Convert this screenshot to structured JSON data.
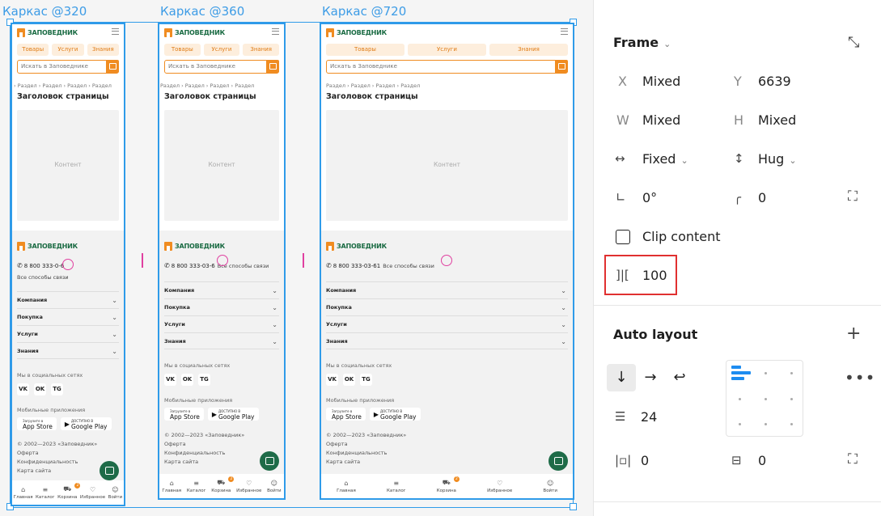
{
  "frames": [
    {
      "label": "Каркас @320",
      "size": "320"
    },
    {
      "label": "Каркас @360",
      "size": "360"
    },
    {
      "label": "Каркас @720",
      "size": "720"
    }
  ],
  "mockup": {
    "logo_text": "ЗАПОВЕДНИК",
    "tabs": [
      "Товары",
      "Услуги",
      "Знания"
    ],
    "search_placeholder": "Искать в Заповеднике",
    "breadcrumb": "Раздел  ›  Раздел  ›  Раздел  ›  Раздел",
    "breadcrumb_short": "›  Раздел  ›  Раздел  ›  Раздел  ›  Раздел",
    "title": "Заголовок страницы",
    "content_label": "Контент",
    "phone": "8 800 333-03-61",
    "phone_cut": "8 800 333-0",
    "phone_cut2": "-6",
    "phone_mid": "8 800 333-03-6",
    "alt_contacts": "Все способы связи",
    "accordion": [
      "Компания",
      "Покупка",
      "Услуги",
      "Знания"
    ],
    "social_title": "Мы в социальных сетях",
    "socials": [
      "VK",
      "OK",
      "TG"
    ],
    "apps_title": "Мобильные приложения",
    "app_store_small": "Загрузите в",
    "app_store": "App Store",
    "google_play_small": "ДОСТУПНО В",
    "google_play": "Google Play",
    "copyright": "© 2002—2023 «Заповедник»",
    "links": [
      "Оферта",
      "Конфиденциальность",
      "Карта сайта"
    ],
    "nav": [
      "Главная",
      "Каталог",
      "Корзина",
      "Избранное",
      "Войти"
    ],
    "nav_icons": [
      "home-icon",
      "catalog-icon",
      "cart-icon",
      "heart-icon",
      "user-icon"
    ],
    "cart_badge": "2"
  },
  "panel": {
    "frame_title": "Frame",
    "x_label": "X",
    "x_value": "Mixed",
    "y_label": "Y",
    "y_value": "6639",
    "w_label": "W",
    "w_value": "Mixed",
    "h_label": "H",
    "h_value": "Mixed",
    "width_mode": "Fixed",
    "height_mode": "Hug",
    "rotation": "0°",
    "radius": "0",
    "clip_label": "Clip content",
    "gap_value": "100",
    "auto_layout_title": "Auto layout",
    "spacing": "24",
    "padding_h": "0",
    "padding_v": "0"
  },
  "colors": {
    "selection": "#2f9be9",
    "accent": "#f08c21",
    "brand_green": "#1a6b43",
    "highlight_red": "#e03030",
    "guide_pink": "#e040a0"
  }
}
